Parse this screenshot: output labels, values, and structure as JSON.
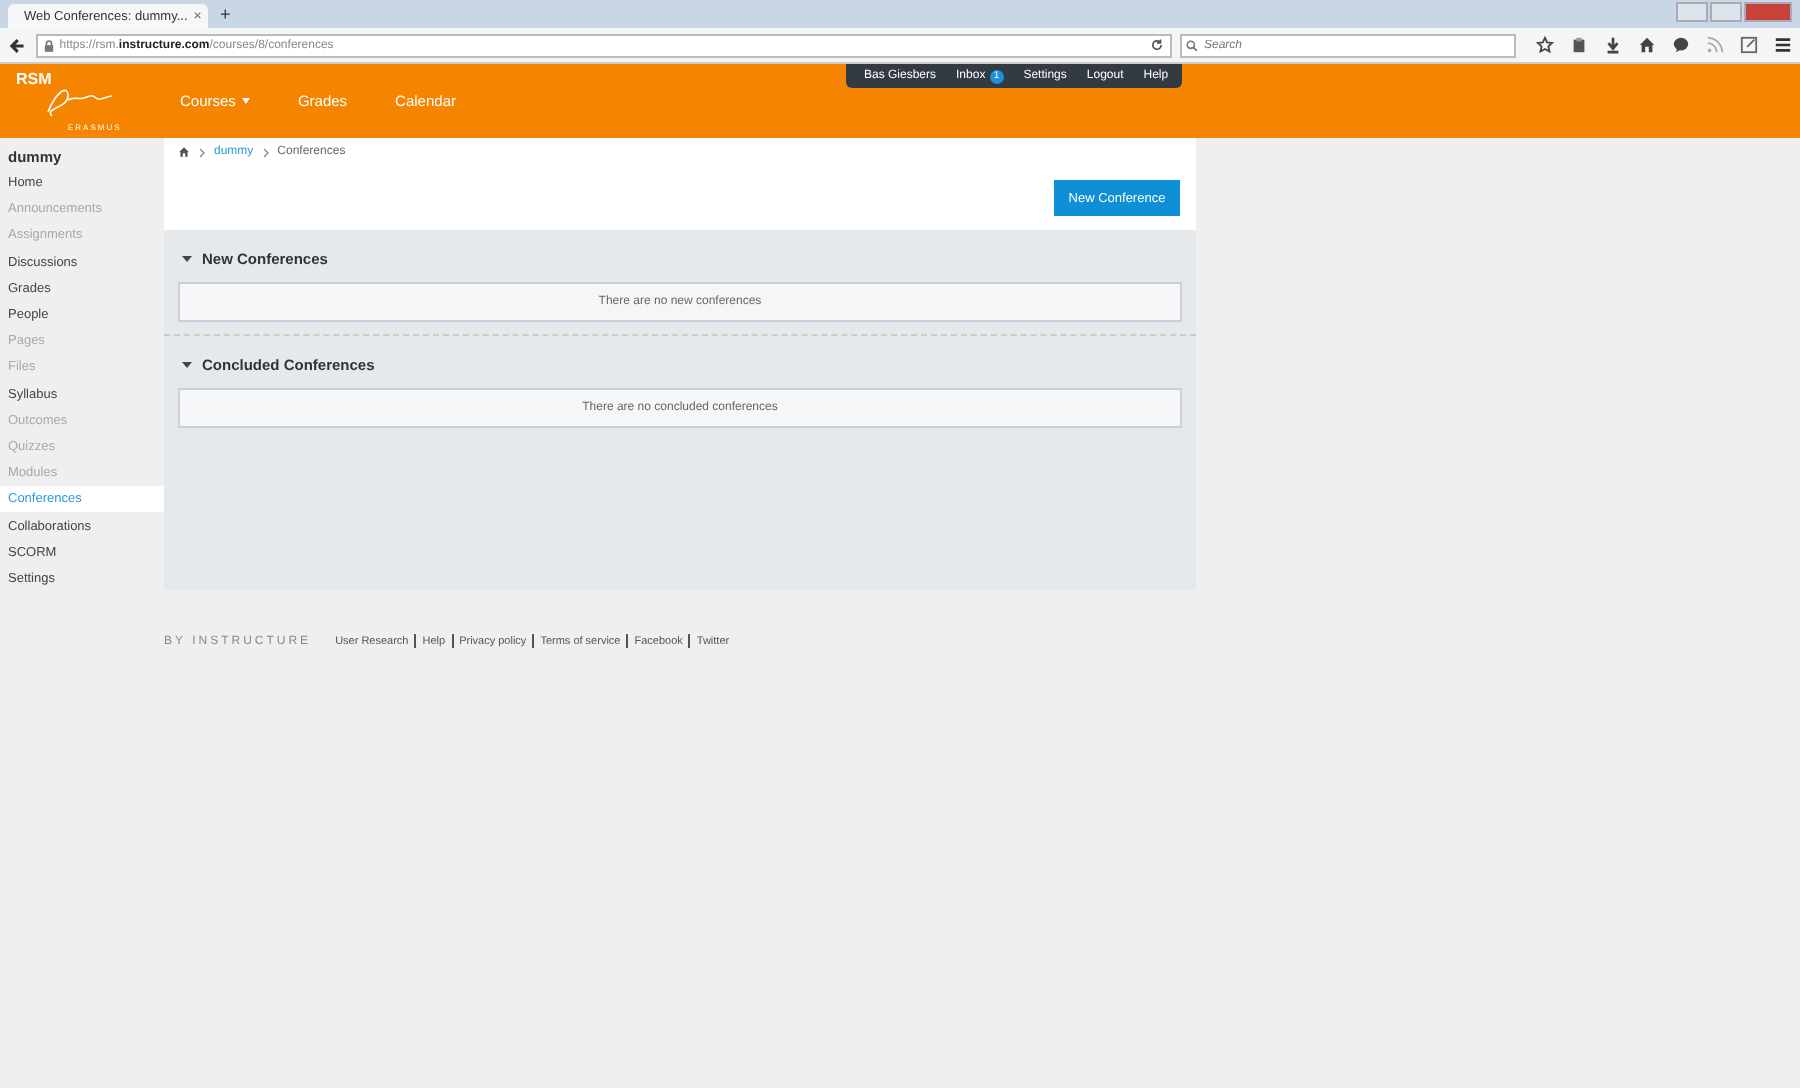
{
  "browser": {
    "tab_title": "Web Conferences: dummy...",
    "tab_close": "×",
    "new_tab": "+",
    "url": "https://rsm.**instructure.com**/courses/8/conferences",
    "search_placeholder": "Search"
  },
  "header": {
    "logo_text": "RSM",
    "logo_subtext": "ERASMUS",
    "nav": [
      {
        "label": "Courses",
        "dropdown": true
      },
      {
        "label": "Grades",
        "dropdown": false
      },
      {
        "label": "Calendar",
        "dropdown": false
      }
    ],
    "user_menu": {
      "user": "Bas Giesbers",
      "inbox": "Inbox",
      "inbox_count": "1",
      "links": [
        "Settings",
        "Logout",
        "Help"
      ]
    }
  },
  "sidebar": {
    "course": "dummy",
    "items": [
      {
        "label": "Home",
        "disabled": false,
        "selected": false
      },
      {
        "label": "Announcements",
        "disabled": true,
        "selected": false
      },
      {
        "label": "Assignments",
        "disabled": true,
        "selected": false
      },
      {
        "label": "Discussions",
        "disabled": false,
        "selected": false
      },
      {
        "label": "Grades",
        "disabled": false,
        "selected": false
      },
      {
        "label": "People",
        "disabled": false,
        "selected": false
      },
      {
        "label": "Pages",
        "disabled": true,
        "selected": false
      },
      {
        "label": "Files",
        "disabled": true,
        "selected": false
      },
      {
        "label": "Syllabus",
        "disabled": false,
        "selected": false
      },
      {
        "label": "Outcomes",
        "disabled": true,
        "selected": false
      },
      {
        "label": "Quizzes",
        "disabled": true,
        "selected": false
      },
      {
        "label": "Modules",
        "disabled": true,
        "selected": false
      },
      {
        "label": "Conferences",
        "disabled": false,
        "selected": true
      },
      {
        "label": "Collaborations",
        "disabled": false,
        "selected": false
      },
      {
        "label": "SCORM",
        "disabled": false,
        "selected": false
      },
      {
        "label": "Settings",
        "disabled": false,
        "selected": false
      }
    ]
  },
  "breadcrumbs": [
    "dummy",
    "Conferences"
  ],
  "new_conference_button": "New Conference",
  "sections": [
    {
      "title": "New Conferences",
      "expanded": true,
      "empty_message": "There are no new conferences"
    },
    {
      "title": "Concluded Conferences",
      "expanded": true,
      "empty_message": "There are no concluded conferences"
    }
  ],
  "footer": {
    "brand": "BY INSTRUCTURE",
    "links": [
      "User Research",
      "Help",
      "Privacy policy",
      "Terms of service",
      "Facebook",
      "Twitter"
    ]
  }
}
